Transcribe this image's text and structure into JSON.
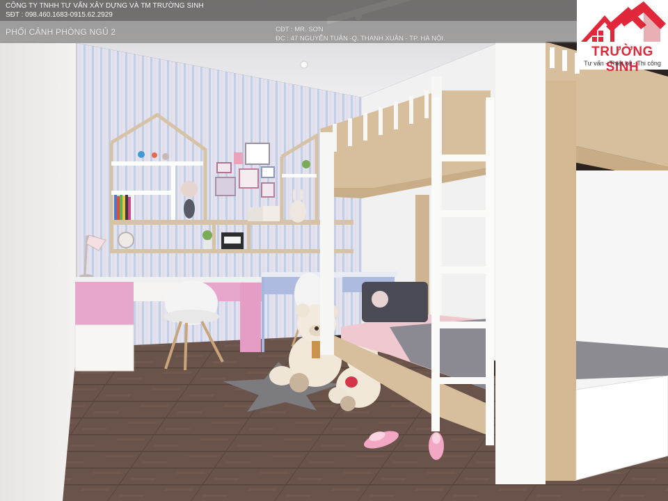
{
  "header": {
    "company_name": "CÔNG TY TNHH TƯ VẤN XÂY DỰNG VÀ TM TRƯỜNG SINH",
    "phone": "SĐT : 098.460.1683-0915.62.2929",
    "view_title": "PHỐI CẢNH PHÒNG  NGỦ 2",
    "owner": "CĐT : MR. SƠN",
    "address": "ĐC   : 47 NGUYỄN TUÂN -Q. THANH XUÂN - TP. HÀ NỘI."
  },
  "logo": {
    "brand": "TRƯỜNG SINH",
    "tagline": "Tư vấn - Thiết kế - Thi công"
  },
  "colors": {
    "brand_red": "#e0283a",
    "brand_dark": "#b81d2c",
    "desk_pink": "#e7a7cd",
    "desk_blue": "#aebbe0",
    "wood_floor": "#6a534a",
    "bunk_wood": "#d7bf9d",
    "bunk_white": "#f7f7f5"
  },
  "illustration": {
    "subject": "children-bedroom-render",
    "objects": [
      "striped-wallpaper",
      "house-shaped-shelves",
      "pink-desk",
      "blue-desk",
      "white-chairs",
      "desk-lamp",
      "teddy-bears",
      "star-rug",
      "bunk-bed",
      "ladder",
      "slippers",
      "wood-floor"
    ]
  }
}
